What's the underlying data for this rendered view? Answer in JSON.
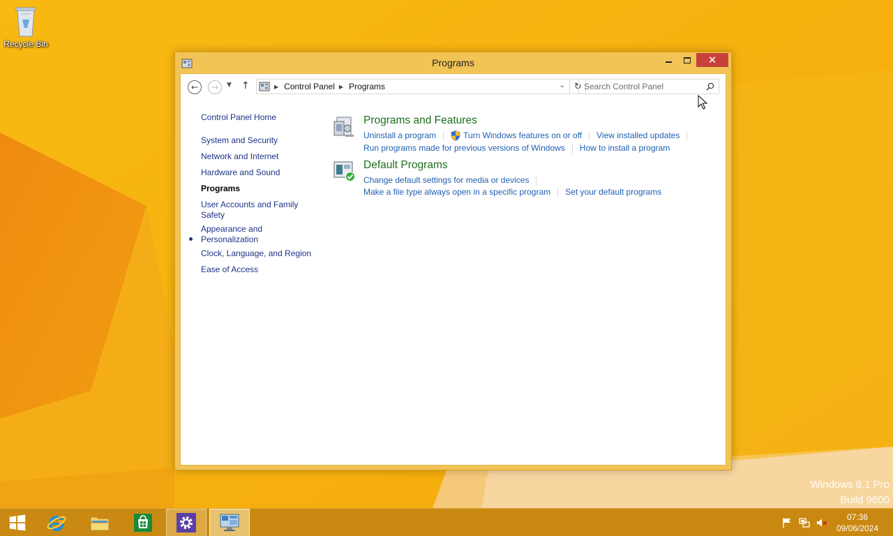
{
  "desktop": {
    "recycle_bin_label": "Recycle Bin",
    "watermark": {
      "line1": "Windows 8.1 Pro",
      "line2": "Build 9600"
    }
  },
  "window": {
    "title": "Programs",
    "close_glyph": "✕",
    "nav": {
      "breadcrumb": [
        "Control Panel",
        "Programs"
      ],
      "search_placeholder": "Search Control Panel"
    },
    "left_nav": [
      {
        "label": "Control Panel Home",
        "active": false
      },
      {
        "label": "System and Security",
        "active": false
      },
      {
        "label": "Network and Internet",
        "active": false
      },
      {
        "label": "Hardware and Sound",
        "active": false
      },
      {
        "label": "Programs",
        "active": true
      },
      {
        "label": "User Accounts and Family Safety",
        "active": false
      },
      {
        "label": "Appearance and Personalization",
        "active": false
      },
      {
        "label": "Clock, Language, and Region",
        "active": false
      },
      {
        "label": "Ease of Access",
        "active": false
      }
    ],
    "sections": [
      {
        "title": "Programs and Features",
        "icon": "programs-features-icon",
        "rows": [
          [
            "Uninstall a program",
            "Turn Windows features on or off",
            "View installed updates"
          ],
          [
            "Run programs made for previous versions of Windows",
            "How to install a program"
          ]
        ]
      },
      {
        "title": "Default Programs",
        "icon": "default-programs-icon",
        "rows": [
          [
            "Change default settings for media or devices"
          ],
          [
            "Make a file type always open in a specific program",
            "Set your default programs"
          ]
        ]
      }
    ]
  },
  "taskbar": {
    "clock": {
      "time": "07:36",
      "date": "09/06/2024"
    },
    "colors": {
      "taskbar": "#c48614",
      "accent": "#f6b20f"
    }
  }
}
